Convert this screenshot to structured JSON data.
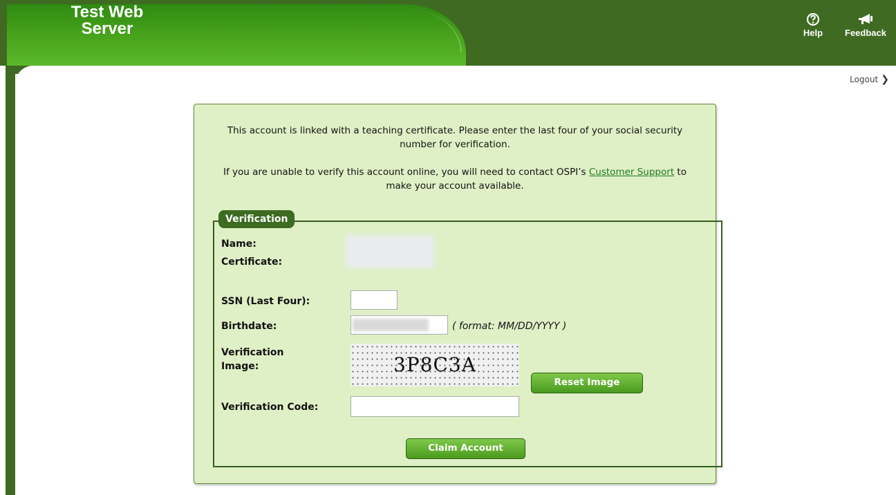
{
  "header": {
    "brand_line1": "Test Web",
    "brand_line2": "Server",
    "help_label": "Help",
    "feedback_label": "Feedback"
  },
  "nav": {
    "logout_label": "Logout"
  },
  "intro": {
    "paragraph1": "This account is linked with a teaching certificate. Please enter the last four of your social security number for verification.",
    "paragraph2_before": "If you are unable to verify this account online, you will need to contact OSPI’s",
    "support_link": "Customer Support",
    "paragraph2_after": "to make your account available."
  },
  "verification": {
    "legend": "Verification",
    "name_label": "Name:",
    "certificate_label": "Certificate:",
    "ssn_label": "SSN (Last Four):",
    "ssn_value": "",
    "birthdate_label": "Birthdate:",
    "birthdate_hint": "( format: MM/DD/YYYY )",
    "image_label_line1": "Verification",
    "image_label_line2": "Image:",
    "captcha_text": "3P8C3A",
    "reset_button": "Reset Image",
    "code_label": "Verification Code:",
    "code_value": "",
    "claim_button": "Claim Account"
  },
  "colors": {
    "header_dark": "#3f6a22",
    "header_green": "#4aa51d",
    "card_bg": "#dff0c6",
    "button": "#5aa82a",
    "link": "#1f7a1f"
  },
  "icons": [
    "help-circle-icon",
    "megaphone-icon",
    "chevron-right-icon"
  ]
}
